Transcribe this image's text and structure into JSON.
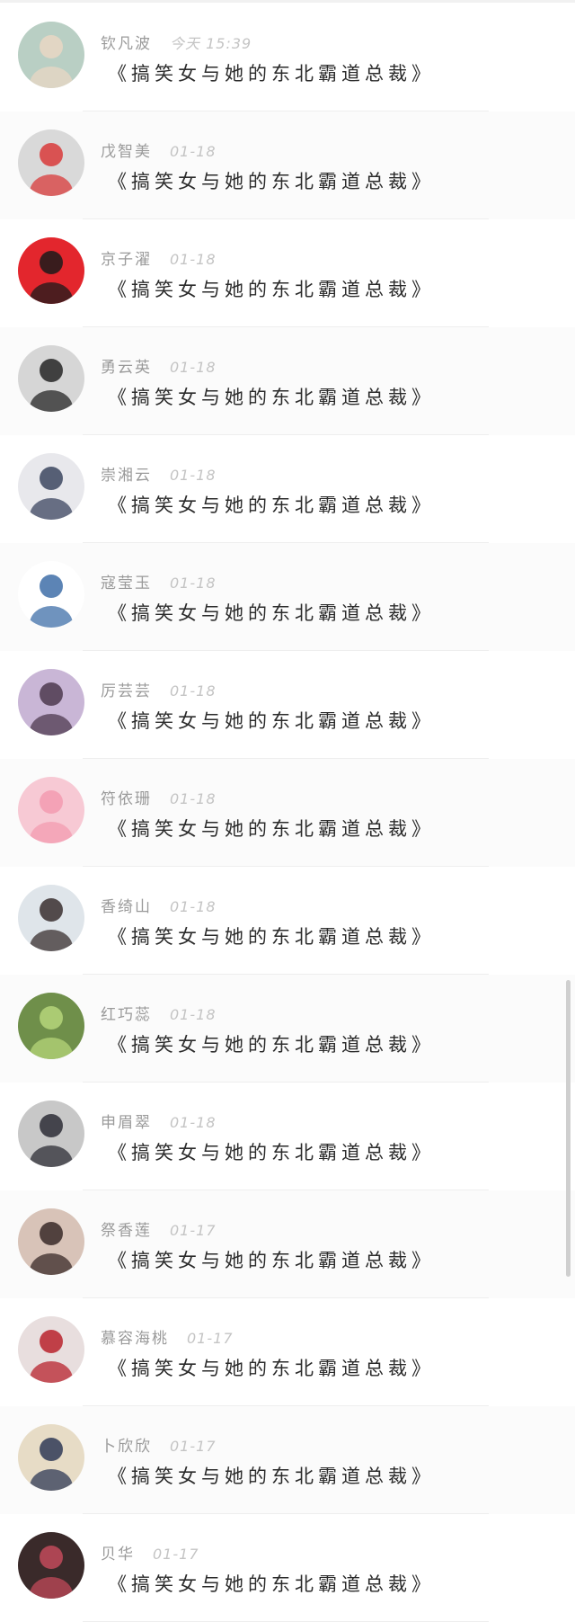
{
  "comments": [
    {
      "author": "钦凡波",
      "time": "今天 15:39",
      "content": "《搞笑女与她的东北霸道总裁》",
      "avatar": {
        "icon": "avatar-photo-beach-icon",
        "bg": "#b9cfc4",
        "fg": "#e9d7c4"
      }
    },
    {
      "author": "戊智美",
      "time": "01-18",
      "content": "《搞笑女与她的东北霸道总裁》",
      "avatar": {
        "icon": "avatar-strawberry-icon",
        "bg": "#d9d9d9",
        "fg": "#d83a3a"
      }
    },
    {
      "author": "京子濯",
      "time": "01-18",
      "content": "《搞笑女与她的东北霸道总裁》",
      "avatar": {
        "icon": "avatar-anime-red-icon",
        "bg": "#e3262d",
        "fg": "#1b1b1b"
      }
    },
    {
      "author": "勇云英",
      "time": "01-18",
      "content": "《搞笑女与她的东北霸道总裁》",
      "avatar": {
        "icon": "avatar-man-portrait-icon",
        "bg": "#d6d6d6",
        "fg": "#262626"
      }
    },
    {
      "author": "崇湘云",
      "time": "01-18",
      "content": "《搞笑女与她的东北霸道总裁》",
      "avatar": {
        "icon": "avatar-anime-swordsman-icon",
        "bg": "#e8e8ec",
        "fg": "#3c4660"
      }
    },
    {
      "author": "寇莹玉",
      "time": "01-18",
      "content": "《搞笑女与她的东北霸道总裁》",
      "avatar": {
        "icon": "avatar-cartoon-couple-icon",
        "bg": "#ffffff",
        "fg": "#3f6fa8"
      }
    },
    {
      "author": "厉芸芸",
      "time": "01-18",
      "content": "《搞笑女与她的东北霸道总裁》",
      "avatar": {
        "icon": "avatar-girl-purple-icon",
        "bg": "#c9b6d6",
        "fg": "#4d3a4f"
      }
    },
    {
      "author": "符依珊",
      "time": "01-18",
      "content": "《搞笑女与她的东北霸道总裁》",
      "avatar": {
        "icon": "avatar-pink-pig-icon",
        "bg": "#f7c9d4",
        "fg": "#f39bb0"
      }
    },
    {
      "author": "香绮山",
      "time": "01-18",
      "content": "《搞笑女与她的东北霸道总裁》",
      "avatar": {
        "icon": "avatar-girl-profile-icon",
        "bg": "#dfe5ea",
        "fg": "#3a2f2f"
      }
    },
    {
      "author": "红巧蕊",
      "time": "01-18",
      "content": "《搞笑女与她的东北霸道总裁》",
      "avatar": {
        "icon": "avatar-green-plant-icon",
        "bg": "#6f8f4a",
        "fg": "#b6d67a"
      }
    },
    {
      "author": "申眉翠",
      "time": "01-18",
      "content": "《搞笑女与她的东北霸道总裁》",
      "avatar": {
        "icon": "avatar-foggy-figure-icon",
        "bg": "#c8c8c8",
        "fg": "#2d2d36"
      }
    },
    {
      "author": "祭香莲",
      "time": "01-17",
      "content": "《搞笑女与她的东北霸道总裁》",
      "avatar": {
        "icon": "avatar-girl-bangs-icon",
        "bg": "#d8c3b8",
        "fg": "#3a2a28"
      }
    },
    {
      "author": "慕容海桃",
      "time": "01-17",
      "content": "《搞笑女与她的东北霸道总裁》",
      "avatar": {
        "icon": "avatar-red-hat-girl-icon",
        "bg": "#e8dede",
        "fg": "#b8232d"
      }
    },
    {
      "author": "卜欣欣",
      "time": "01-17",
      "content": "《搞笑女与她的东北霸道总裁》",
      "avatar": {
        "icon": "avatar-chair-room-icon",
        "bg": "#e7dcc6",
        "fg": "#2f3a56"
      }
    },
    {
      "author": "贝华",
      "time": "01-17",
      "content": "《搞笑女与她的东北霸道总裁》",
      "avatar": {
        "icon": "avatar-flower-skull-icon",
        "bg": "#3a2a2a",
        "fg": "#c24a5a"
      }
    }
  ]
}
